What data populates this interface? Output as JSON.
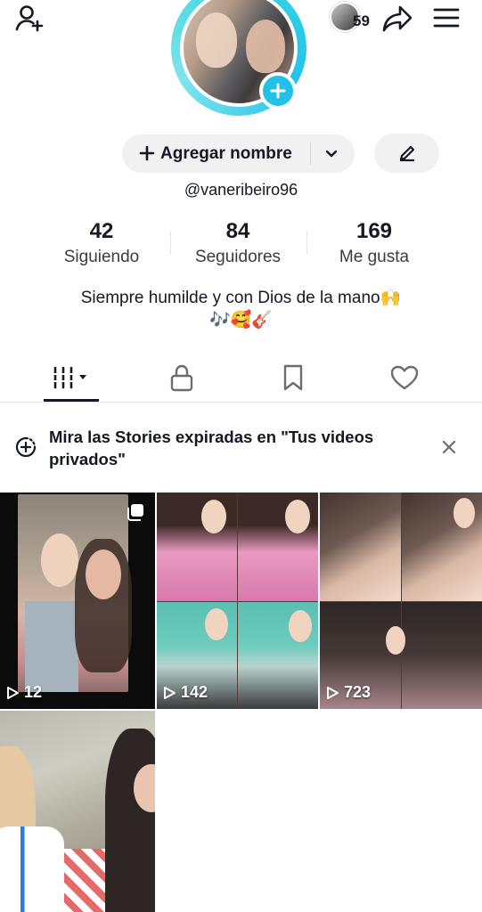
{
  "header": {
    "story_count": "59",
    "icons": [
      "add-friend-icon",
      "share-icon",
      "menu-icon"
    ]
  },
  "profile": {
    "add_name_label": "Agregar nombre",
    "username": "@vaneribeiro96",
    "bio_line1": "Siempre humilde y con Dios de la mano🙌",
    "bio_line2": "🎶🥰🎸"
  },
  "stats": [
    {
      "value": "42",
      "label": "Siguiendo"
    },
    {
      "value": "84",
      "label": "Seguidores"
    },
    {
      "value": "169",
      "label": "Me gusta"
    }
  ],
  "tabs": [
    {
      "icon": "grid-icon",
      "active": true
    },
    {
      "icon": "lock-icon",
      "active": false
    },
    {
      "icon": "bookmark-icon",
      "active": false
    },
    {
      "icon": "heart-icon",
      "active": false
    }
  ],
  "notice": {
    "text": "Mira las Stories expiradas en \"Tus videos privados\""
  },
  "videos": [
    {
      "views": "12",
      "multi": true
    },
    {
      "views": "142"
    },
    {
      "views": "723"
    },
    {
      "views": ""
    }
  ],
  "colors": {
    "accent": "#23c1e6",
    "text": "#161823",
    "pill": "#f1f1f2"
  }
}
